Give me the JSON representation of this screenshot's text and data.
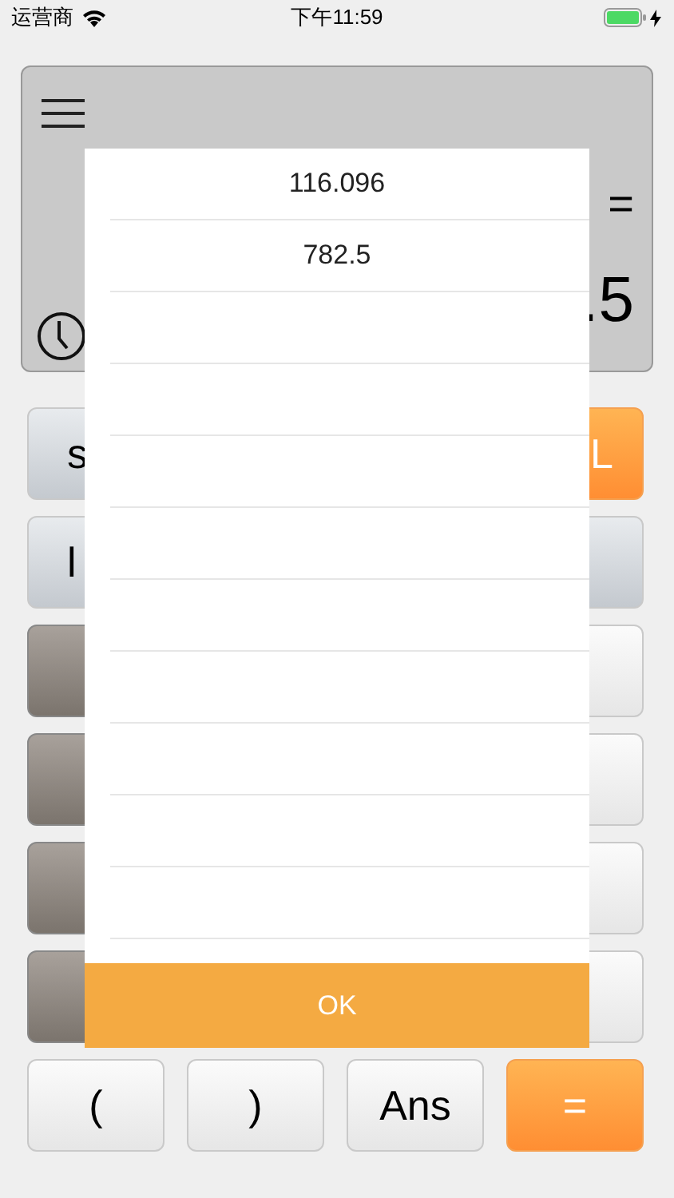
{
  "status_bar": {
    "carrier": "运营商",
    "time": "下午11:59"
  },
  "display": {
    "expression": "=",
    "result": ".5"
  },
  "keypad": {
    "covered_rows": [
      {
        "left": {
          "kind": "gray",
          "label": "s"
        },
        "right": {
          "kind": "orange",
          "label": "L"
        }
      },
      {
        "left": {
          "kind": "gray",
          "label": "l"
        },
        "right": {
          "kind": "gray"
        }
      },
      {
        "left": {
          "kind": "brown"
        },
        "right": {
          "kind": "white"
        }
      },
      {
        "left": {
          "kind": "brown"
        },
        "right": {
          "kind": "white"
        }
      },
      {
        "left": {
          "kind": "brown"
        },
        "right": {
          "kind": "white"
        }
      },
      {
        "left": {
          "kind": "brown"
        },
        "right": {
          "kind": "white"
        }
      }
    ],
    "bottom_row": [
      {
        "kind": "white",
        "label": "("
      },
      {
        "kind": "white",
        "label": ")"
      },
      {
        "kind": "white",
        "label": "Ans"
      },
      {
        "kind": "orange",
        "label": "="
      }
    ]
  },
  "history_dialog": {
    "rows": [
      {
        "value": "116.096"
      },
      {
        "value": "782.5"
      },
      {},
      {},
      {},
      {},
      {},
      {},
      {},
      {},
      {}
    ],
    "ok_button": "OK"
  }
}
